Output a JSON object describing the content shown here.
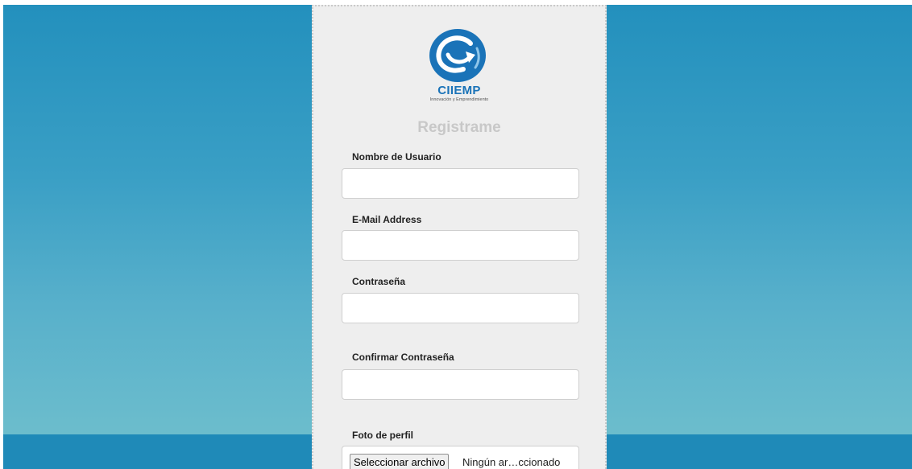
{
  "logo": {
    "name": "CIIEMP",
    "tagline": "Innovación y Emprendimiento",
    "icon": "ciiemp-swirl-arrow-logo"
  },
  "form": {
    "title": "Registrame",
    "fields": {
      "username": {
        "label": "Nombre de Usuario",
        "value": ""
      },
      "email": {
        "label": "E-Mail Address",
        "value": ""
      },
      "password": {
        "label": "Contraseña",
        "value": ""
      },
      "password_confirm": {
        "label": "Confirmar Contraseña",
        "value": ""
      },
      "photo": {
        "label": "Foto de perfil",
        "button_label": "Seleccionar archivo",
        "status": "Ningún ar…ccionado"
      }
    }
  },
  "colors": {
    "bg_top": "#2390bd",
    "bg_bottom": "#6cbdcc",
    "card": "#eeeeee",
    "brand": "#1a73b8",
    "title": "#c8c8c8"
  }
}
